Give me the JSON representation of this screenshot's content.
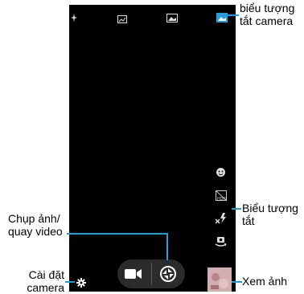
{
  "annotations": {
    "top_right": [
      "biểu tượng",
      "tắt camera"
    ],
    "right_middle": [
      "Biểu tượng",
      "tắt"
    ],
    "left_capture": [
      "Chụp ảnh/",
      "quay video"
    ],
    "left_settings": [
      "Cài đặt",
      "camera"
    ],
    "bottom_right": "Xem ảnh"
  },
  "colors": {
    "screen_bg": "#000000",
    "callout_line": "#1aa0d8",
    "pill_bg": "#2b2b2b",
    "mode_active": "#1ea0e0"
  },
  "icons": {
    "top_bar": [
      "sparkle-icon",
      "panorama-icon",
      "photo-mode-icon",
      "gallery-mode-icon"
    ],
    "side_bar": [
      "face-icon",
      "hdr-icon",
      "flash-off-icon",
      "switch-camera-icon"
    ],
    "bottom": [
      "settings-icon",
      "video-camera-icon",
      "shutter-icon",
      "thumbnail"
    ]
  }
}
